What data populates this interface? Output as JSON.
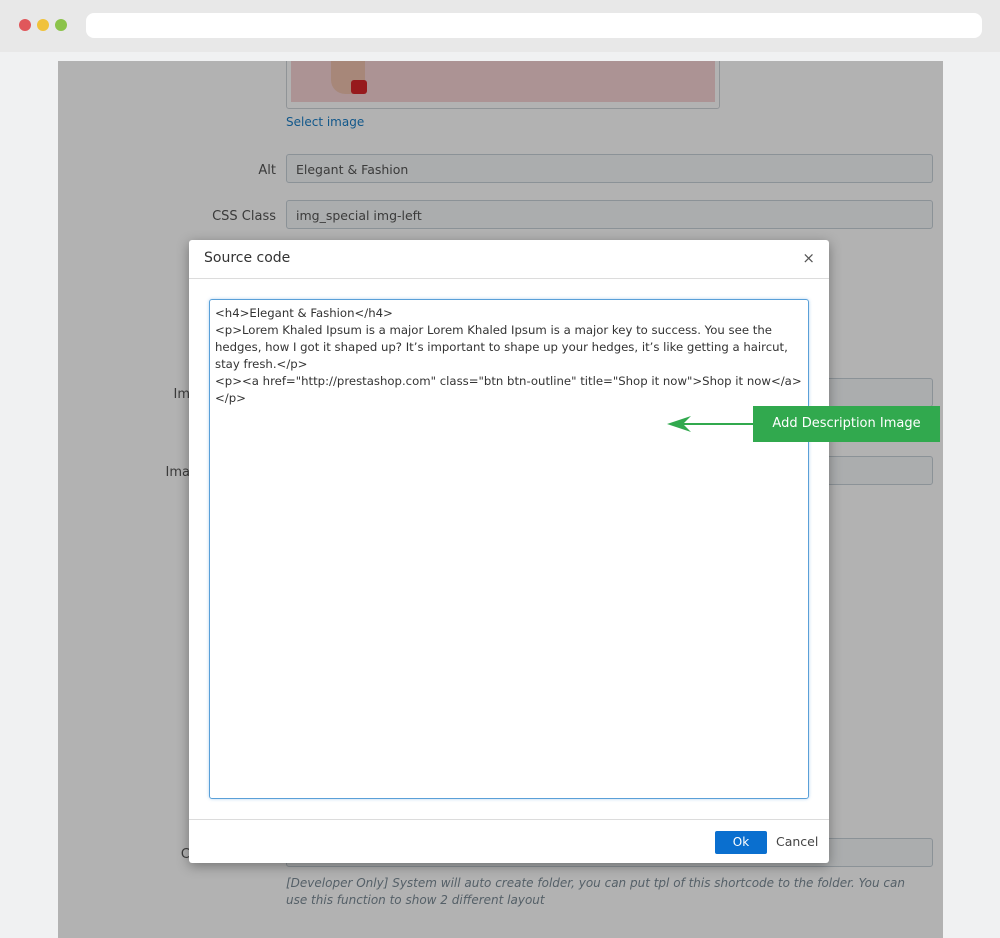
{
  "browser": {
    "url": ""
  },
  "form": {
    "select_image_link": "Select image",
    "alt_label": "Alt",
    "alt_value": "Elegant & Fashion",
    "css_class_label": "CSS Class",
    "css_class_value": "img_special img-left",
    "hidden_label_1": "Im",
    "hidden_label_2": "Ima",
    "hidden_label_3": "C",
    "help_text": "[Developer Only] System will auto create folder, you can put tpl of this shortcode to the folder. You can use this function to show 2 different layout"
  },
  "modal": {
    "title": "Source code",
    "close_symbol": "×",
    "code": "<h4>Elegant & Fashion</h4>\n<p>Lorem Khaled Ipsum is a major Lorem Khaled Ipsum is a major key to success. You see the hedges, how I got it shaped up? It’s important to shape up your hedges, it’s like getting a haircut, stay fresh.</p>\n<p><a href=\"http://prestashop.com\" class=\"btn btn-outline\" title=\"Shop it now\">Shop it now</a></p>",
    "ok_label": "Ok",
    "cancel_label": "Cancel"
  },
  "annotation": {
    "callout_text": "Add Description Image",
    "color": "#31a94e"
  },
  "icons": [
    "close-icon",
    "arrow-left-icon"
  ]
}
